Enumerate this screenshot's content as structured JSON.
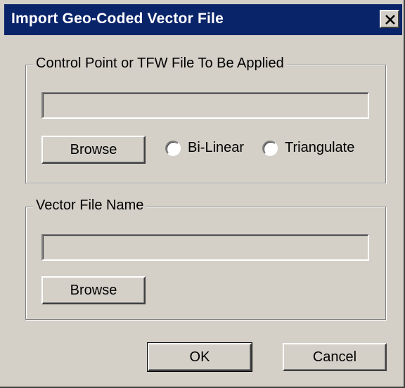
{
  "dialog": {
    "title": "Import Geo-Coded Vector File",
    "close_label": "X"
  },
  "control_group": {
    "label": "Control Point or TFW File To Be Applied",
    "file_value": "",
    "browse_label": "Browse",
    "radio_options": [
      "Bi-Linear",
      "Triangulate"
    ]
  },
  "vector_group": {
    "label": "Vector File Name",
    "file_value": "",
    "browse_label": "Browse"
  },
  "footer": {
    "ok_label": "OK",
    "cancel_label": "Cancel"
  },
  "colors": {
    "title_bar": "#0a246a",
    "face": "#d4d0c8"
  }
}
